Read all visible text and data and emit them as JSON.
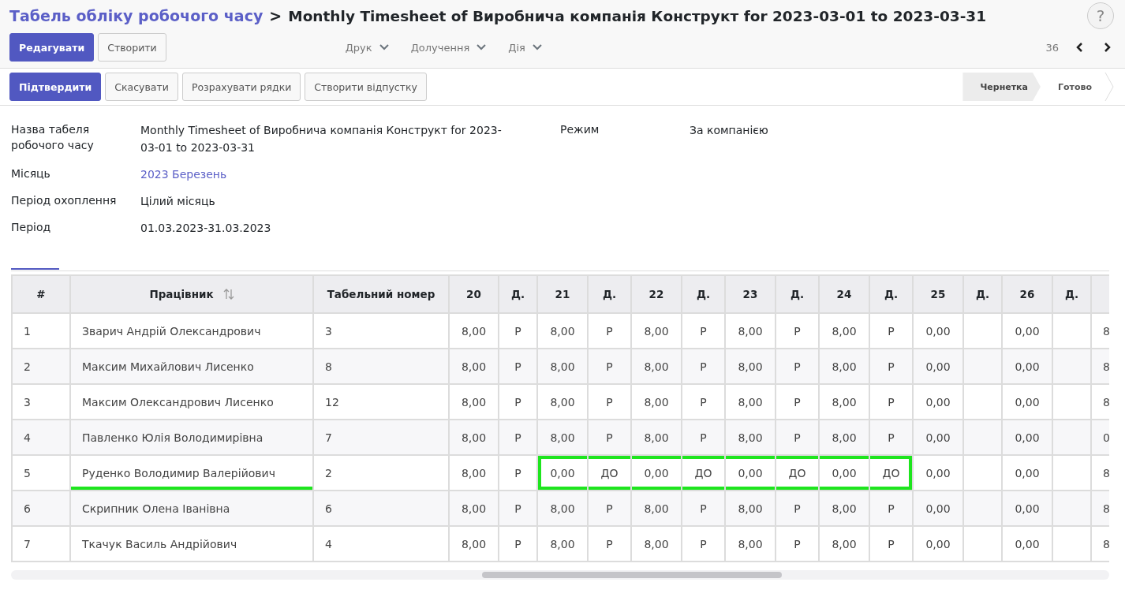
{
  "breadcrumb": {
    "parent": "Табель обліку робочого часу",
    "separator": ">",
    "current": "Monthly Timesheet of Виробнича компанія Конструкт for 2023-03-01 to 2023-03-31"
  },
  "help_button": "?",
  "control_buttons": [
    {
      "label": "Редагувати",
      "primary": true
    },
    {
      "label": "Створити",
      "primary": false
    }
  ],
  "menus": [
    "Друк",
    "Долучення",
    "Дія"
  ],
  "pager": {
    "count": "36"
  },
  "action_buttons": [
    {
      "label": "Підтвердити",
      "primary": true
    },
    {
      "label": "Скасувати",
      "primary": false
    },
    {
      "label": "Розрахувати рядки",
      "primary": false
    },
    {
      "label": "Створити відпустку",
      "primary": false
    }
  ],
  "status_steps": [
    {
      "label": "Чернетка",
      "selected": true
    },
    {
      "label": "Готово",
      "selected": false
    }
  ],
  "fields_left": [
    {
      "label": "Назва табеля робочого часу",
      "value": "Monthly Timesheet of Виробнича компанія Конструкт for 2023-03-01 to 2023-03-31",
      "link": false
    },
    {
      "label": "Місяць",
      "value": "2023 Березень",
      "link": true
    },
    {
      "label": "Період охоплення",
      "value": "Цілий місяць",
      "link": false
    },
    {
      "label": "Період",
      "value": "01.03.2023-31.03.2023",
      "link": false
    }
  ],
  "fields_right": [
    {
      "label": "Режим",
      "value": "За компанією",
      "link": false
    }
  ],
  "table": {
    "columns": [
      "#",
      "Працівник",
      "Табельний номер",
      "20",
      "Д.",
      "21",
      "Д.",
      "22",
      "Д.",
      "23",
      "Д.",
      "24",
      "Д.",
      "25",
      "Д.",
      "26",
      "Д."
    ],
    "rows": [
      {
        "number": "1",
        "employee": "Зварич Андрій Олександрович",
        "tab_number": "3",
        "underlined": false,
        "days": [
          {
            "hours": "8,00",
            "code": "Р",
            "circled": false
          },
          {
            "hours": "8,00",
            "code": "Р",
            "circled": false
          },
          {
            "hours": "8,00",
            "code": "Р",
            "circled": false
          },
          {
            "hours": "8,00",
            "code": "Р",
            "circled": false
          },
          {
            "hours": "8,00",
            "code": "Р",
            "circled": false
          },
          {
            "hours": "0,00",
            "circled": false
          },
          {
            "hours": "0,00",
            "circled": false
          }
        ],
        "column_18": "8"
      },
      {
        "number": "2",
        "employee": "Максим Михайлович Лисенко",
        "tab_number": "8",
        "underlined": false,
        "days": [
          {
            "hours": "8,00",
            "code": "Р",
            "circled": false
          },
          {
            "hours": "8,00",
            "code": "Р",
            "circled": false
          },
          {
            "hours": "8,00",
            "code": "Р",
            "circled": false
          },
          {
            "hours": "8,00",
            "code": "Р",
            "circled": false
          },
          {
            "hours": "8,00",
            "code": "Р",
            "circled": false
          },
          {
            "hours": "0,00",
            "circled": false
          },
          {
            "hours": "0,00",
            "circled": false
          }
        ],
        "column_18": "8"
      },
      {
        "number": "3",
        "employee": "Максим Олександрович Лисенко",
        "tab_number": "12",
        "underlined": false,
        "days": [
          {
            "hours": "8,00",
            "code": "Р",
            "circled": false
          },
          {
            "hours": "8,00",
            "code": "Р",
            "circled": false
          },
          {
            "hours": "8,00",
            "code": "Р",
            "circled": false
          },
          {
            "hours": "8,00",
            "code": "Р",
            "circled": false
          },
          {
            "hours": "8,00",
            "code": "Р",
            "circled": false
          },
          {
            "hours": "0,00",
            "circled": false
          },
          {
            "hours": "0,00",
            "circled": false
          }
        ],
        "column_18": "8"
      },
      {
        "number": "4",
        "employee": "Павленко Юлія Володимирівна",
        "tab_number": "7",
        "underlined": false,
        "days": [
          {
            "hours": "8,00",
            "code": "Р",
            "circled": false
          },
          {
            "hours": "8,00",
            "code": "Р",
            "circled": false
          },
          {
            "hours": "8,00",
            "code": "Р",
            "circled": false
          },
          {
            "hours": "8,00",
            "code": "Р",
            "circled": false
          },
          {
            "hours": "8,00",
            "code": "Р",
            "circled": false
          },
          {
            "hours": "0,00",
            "circled": false
          },
          {
            "hours": "0,00",
            "circled": false
          }
        ],
        "column_18": "0"
      },
      {
        "number": "5",
        "employee": "Руденко Володимир Валерійович",
        "tab_number": "2",
        "underlined": true,
        "days": [
          {
            "hours": "8,00",
            "code": "Р",
            "circled": false
          },
          {
            "hours": "0,00",
            "code": "ДО",
            "circled": true
          },
          {
            "hours": "0,00",
            "code": "ДО",
            "circled": true
          },
          {
            "hours": "0,00",
            "code": "ДО",
            "circled": true
          },
          {
            "hours": "0,00",
            "code": "ДО",
            "circled": true
          },
          {
            "hours": "0,00",
            "circled": false
          },
          {
            "hours": "0,00",
            "circled": false
          }
        ],
        "column_18": "8"
      },
      {
        "number": "6",
        "employee": "Скрипник Олена Іванівна",
        "tab_number": "6",
        "underlined": false,
        "days": [
          {
            "hours": "8,00",
            "code": "Р",
            "circled": false
          },
          {
            "hours": "8,00",
            "code": "Р",
            "circled": false
          },
          {
            "hours": "8,00",
            "code": "Р",
            "circled": false
          },
          {
            "hours": "8,00",
            "code": "Р",
            "circled": false
          },
          {
            "hours": "8,00",
            "code": "Р",
            "circled": false
          },
          {
            "hours": "0,00",
            "circled": false
          },
          {
            "hours": "0,00",
            "circled": false
          }
        ],
        "column_18": "8"
      },
      {
        "number": "7",
        "employee": "Ткачук Василь Андрійович",
        "tab_number": "4",
        "underlined": false,
        "days": [
          {
            "hours": "8,00",
            "code": "Р",
            "circled": false
          },
          {
            "hours": "8,00",
            "code": "Р",
            "circled": false
          },
          {
            "hours": "8,00",
            "code": "Р",
            "circled": false
          },
          {
            "hours": "8,00",
            "code": "Р",
            "circled": false
          },
          {
            "hours": "8,00",
            "code": "Р",
            "circled": false
          },
          {
            "hours": "0,00",
            "circled": false
          },
          {
            "hours": "0,00",
            "circled": false
          }
        ],
        "column_18": "8"
      }
    ]
  }
}
